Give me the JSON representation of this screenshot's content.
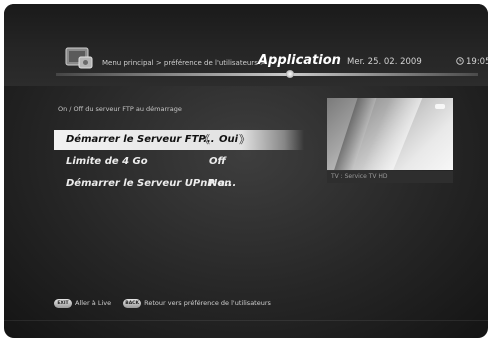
{
  "header": {
    "breadcrumb": "Menu principal > préférence de l'utilisateurs >",
    "title": "Application",
    "date": "Mer. 25. 02. 2009",
    "time": "19:05",
    "app_icon": "settings-app-icon",
    "clock_icon": "clock-icon"
  },
  "subtitle": "On / Off du serveur FTP au démarrage",
  "menu": [
    {
      "label": "Démarrer le Serveur FTP...",
      "value": "Oui",
      "selected": true,
      "left_arrow": "《",
      "right_arrow": "》"
    },
    {
      "label": "Limite de 4 Go",
      "value": "Off",
      "selected": false
    },
    {
      "label": "Démarrer le Serveur UPnP a...",
      "value": "Non",
      "selected": false
    }
  ],
  "preview": {
    "channel": "TV : Service TV HD"
  },
  "footer": {
    "exit_key": "EXIT",
    "exit_label": "Aller à Live",
    "back_key": "BACK",
    "back_label": "Retour vers préférence de l'utilisateurs"
  },
  "colors": {
    "background": "#262626",
    "highlight": "#eeeeee",
    "text": "#ececec"
  }
}
